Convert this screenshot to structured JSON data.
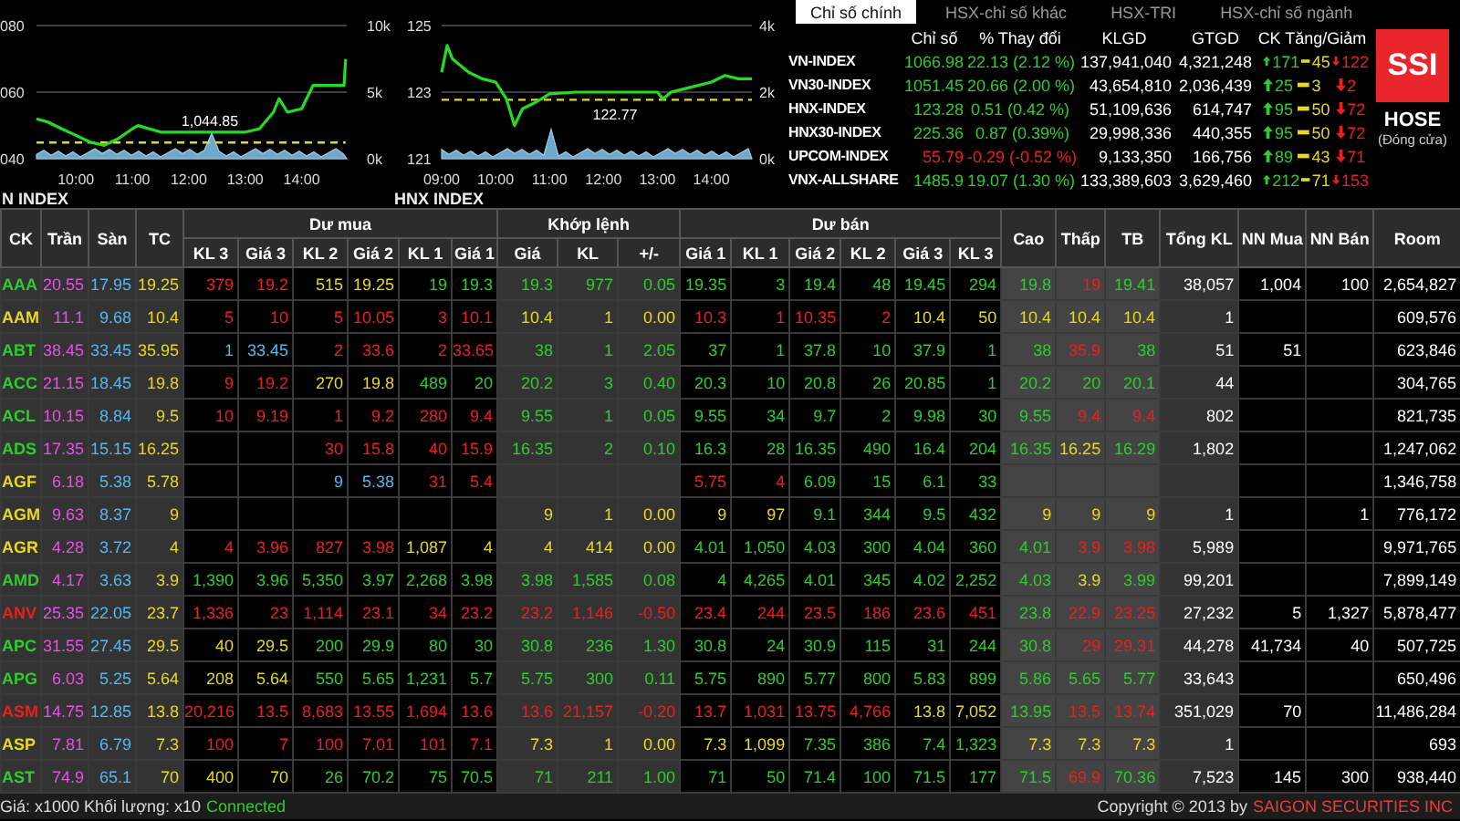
{
  "charts": [
    {
      "title": "N INDEX",
      "right_ticks": [
        "10k",
        "5k",
        "0k"
      ],
      "chart_data": {
        "type": "line",
        "xlim": [
          9.3,
          14.8
        ],
        "ylim": [
          40,
          80
        ],
        "yticks": [
          {
            "value": 80,
            "label": "080"
          },
          {
            "value": 60,
            "label": "060"
          },
          {
            "value": 40,
            "label": "040"
          }
        ],
        "xticks": [
          {
            "value": 10,
            "label": "10:00"
          },
          {
            "value": 11,
            "label": "11:00"
          },
          {
            "value": 12,
            "label": "12:00"
          },
          {
            "value": 13,
            "label": "13:00"
          },
          {
            "value": 14,
            "label": "14:00"
          }
        ],
        "x": [
          9.3,
          9.5,
          9.75,
          10,
          10.25,
          10.5,
          10.75,
          11,
          11.1,
          11.5,
          12,
          12.5,
          13,
          13.25,
          13.5,
          13.6,
          13.75,
          14,
          14.2,
          14.5,
          14.75,
          14.78
        ],
        "series": [
          {
            "color": "#22dd22",
            "values": [
              52,
              51,
              49,
              47,
              45,
              44,
              46,
              49,
              50,
              48,
              48,
              48,
              48,
              49,
              54,
              58,
              54,
              55,
              62,
              62,
              62,
              70
            ]
          },
          {
            "name": "1,044.85",
            "color": "#e8d820",
            "line_style": "dashed",
            "values": [
              44.85,
              44.85,
              44.85,
              44.85,
              44.85,
              44.85,
              44.85,
              44.85,
              44.85,
              44.85,
              44.85,
              44.85,
              44.85,
              44.85,
              44.85,
              44.85,
              44.85,
              44.85,
              44.85,
              44.85,
              44.85,
              44.85
            ]
          }
        ]
      }
    },
    {
      "title": "HNX INDEX",
      "right_ticks": [
        "4k",
        "2k",
        "0k"
      ],
      "chart_data": {
        "type": "line",
        "xlim": [
          9,
          14.75
        ],
        "ylim": [
          121,
          125
        ],
        "yticks": [
          125,
          123,
          121
        ],
        "xticks": [
          {
            "value": 9,
            "label": "09:00"
          },
          {
            "value": 10,
            "label": "10:00"
          },
          {
            "value": 11,
            "label": "11:00"
          },
          {
            "value": 12,
            "label": "12:00"
          },
          {
            "value": 13,
            "label": "13:00"
          },
          {
            "value": 14,
            "label": "14:00"
          }
        ],
        "x": [
          9.0,
          9.1,
          9.2,
          9.5,
          9.75,
          10,
          10.2,
          10.35,
          10.5,
          10.75,
          11,
          11.5,
          12,
          12.5,
          13,
          13.1,
          13.25,
          13.5,
          14,
          14.25,
          14.5,
          14.75
        ],
        "series": [
          {
            "color": "#22dd22",
            "values": [
              123.6,
              124.4,
              124,
              123.6,
              123.4,
              123.3,
              122.8,
              122.0,
              122.5,
              122.7,
              122.95,
              123,
              123,
              123,
              123,
              122.8,
              123,
              123.1,
              123.3,
              123.5,
              123.4,
              123.4
            ]
          },
          {
            "name": "122.77",
            "color": "#e8d820",
            "line_style": "dashed",
            "values": [
              122.77,
              122.77,
              122.77,
              122.77,
              122.77,
              122.77,
              122.77,
              122.77,
              122.77,
              122.77,
              122.77,
              122.77,
              122.77,
              122.77,
              122.77,
              122.77,
              122.77,
              122.77,
              122.77,
              122.77,
              122.77,
              122.77
            ]
          }
        ]
      }
    }
  ],
  "index_tabs": [
    {
      "label": "Chỉ số chính",
      "selected": true
    },
    {
      "label": "HSX-chỉ số khác",
      "selected": false
    },
    {
      "label": "HSX-TRI",
      "selected": false
    },
    {
      "label": "HSX-chỉ số ngành",
      "selected": false
    }
  ],
  "index_columns": [
    "Chỉ số",
    "% Thay đổi",
    "KLGD",
    "GTGD",
    "CK Tăng/Giảm"
  ],
  "indices": [
    {
      "name": "VN-INDEX",
      "value": "1066.98",
      "change": "22.13 (2.12 %)",
      "klgd": "137,941,040",
      "gtgd": "4,321,248",
      "up": "171",
      "same": "45",
      "down": "122"
    },
    {
      "name": "VN30-INDEX",
      "value": "1051.45",
      "change": "20.66 (2.00 %)",
      "klgd": "43,654,810",
      "gtgd": "2,036,439",
      "up": "25",
      "same": "3",
      "down": "2"
    },
    {
      "name": "HNX-INDEX",
      "value": "123.28",
      "change": "0.51 (0.42 %)",
      "klgd": "51,109,636",
      "gtgd": "614,747",
      "up": "95",
      "same": "50",
      "down": "72"
    },
    {
      "name": "HNX30-INDEX",
      "value": "225.36",
      "change": "0.87 (0.39%)",
      "klgd": "29,998,336",
      "gtgd": "440,355",
      "up": "95",
      "same": "50",
      "down": "72"
    },
    {
      "name": "UPCOM-INDEX",
      "value": "55.79",
      "change": "-0.29 (-0.52 %)",
      "klgd": "9,133,350",
      "gtgd": "166,756",
      "up": "89",
      "same": "43",
      "down": "71"
    },
    {
      "name": "VNX-ALLSHARE",
      "value": "1485.9",
      "change": "19.07 (1.30 %)",
      "klgd": "133,389,603",
      "gtgd": "3,629,460",
      "up": "212",
      "same": "71",
      "down": "153"
    }
  ],
  "logo": {
    "text": "SSI",
    "exchange": "HOSE",
    "status": "(Đóng cửa)"
  },
  "board": {
    "groups": [
      {
        "label": "CK"
      },
      {
        "label": "Trần"
      },
      {
        "label": "Sàn"
      },
      {
        "label": "TC"
      },
      {
        "label": "Dư mua",
        "columns": [
          "KL 3",
          "Giá 3",
          "KL 2",
          "Giá 2",
          "KL 1",
          "Giá 1"
        ]
      },
      {
        "label": "Khớp lệnh",
        "columns": [
          "Giá",
          "KL",
          "+/-"
        ]
      },
      {
        "label": "Dư bán",
        "columns": [
          "Giá 1",
          "KL 1",
          "Giá 2",
          "KL 2",
          "Giá 3",
          "KL 3"
        ]
      },
      {
        "label": "Cao"
      },
      {
        "label": "Thấp"
      },
      {
        "label": "TB"
      },
      {
        "label": "Tổng KL"
      },
      {
        "label": "NN Mua"
      },
      {
        "label": "NN Bán"
      },
      {
        "label": "Room"
      }
    ],
    "rows": [
      [
        "AAA",
        "20.55",
        "17.95",
        "19.25",
        "379",
        "19.2",
        "515",
        "19.25",
        "19",
        "19.3",
        "19.3",
        "977",
        "0.05",
        "19.35",
        "3",
        "19.4",
        "48",
        "19.45",
        "294",
        "19.8",
        "19",
        "19.41",
        "38,057",
        "1,004",
        "100",
        "2,654,827"
      ],
      [
        "AAM",
        "11.1",
        "9.68",
        "10.4",
        "5",
        "10",
        "5",
        "10.05",
        "3",
        "10.1",
        "10.4",
        "1",
        "0.00",
        "10.3",
        "1",
        "10.35",
        "2",
        "10.4",
        "50",
        "10.4",
        "10.4",
        "10.4",
        "1",
        "",
        "",
        "609,576"
      ],
      [
        "ABT",
        "38.45",
        "33.45",
        "35.95",
        "1",
        "33.45",
        "2",
        "33.6",
        "2",
        "33.65",
        "38",
        "1",
        "2.05",
        "37",
        "1",
        "37.8",
        "10",
        "37.9",
        "1",
        "38",
        "35.9",
        "38",
        "51",
        "51",
        "",
        "623,846"
      ],
      [
        "ACC",
        "21.15",
        "18.45",
        "19.8",
        "9",
        "19.2",
        "270",
        "19.8",
        "489",
        "20",
        "20.2",
        "3",
        "0.40",
        "20.3",
        "10",
        "20.8",
        "26",
        "20.85",
        "1",
        "20.2",
        "20",
        "20.1",
        "44",
        "",
        "",
        "304,765"
      ],
      [
        "ACL",
        "10.15",
        "8.84",
        "9.5",
        "10",
        "9.19",
        "1",
        "9.2",
        "280",
        "9.4",
        "9.55",
        "1",
        "0.05",
        "9.55",
        "34",
        "9.7",
        "2",
        "9.98",
        "30",
        "9.55",
        "9.4",
        "9.4",
        "802",
        "",
        "",
        "821,735"
      ],
      [
        "ADS",
        "17.35",
        "15.15",
        "16.25",
        "",
        "",
        "30",
        "15.8",
        "40",
        "15.9",
        "16.35",
        "2",
        "0.10",
        "16.3",
        "28",
        "16.35",
        "490",
        "16.4",
        "204",
        "16.35",
        "16.25",
        "16.29",
        "1,802",
        "",
        "",
        "1,247,062"
      ],
      [
        "AGF",
        "6.18",
        "5.38",
        "5.78",
        "",
        "",
        "9",
        "5.38",
        "31",
        "5.4",
        "",
        "",
        "",
        "5.75",
        "4",
        "6.09",
        "15",
        "6.1",
        "33",
        "",
        "",
        "",
        "",
        "",
        "",
        "1,346,758"
      ],
      [
        "AGM",
        "9.63",
        "8.37",
        "9",
        "",
        "",
        "",
        "",
        "",
        "",
        "9",
        "1",
        "0.00",
        "9",
        "97",
        "9.1",
        "344",
        "9.5",
        "432",
        "9",
        "9",
        "9",
        "1",
        "",
        "1",
        "776,172"
      ],
      [
        "AGR",
        "4.28",
        "3.72",
        "4",
        "4",
        "3.96",
        "827",
        "3.98",
        "1,087",
        "4",
        "4",
        "414",
        "0.00",
        "4.01",
        "1,050",
        "4.03",
        "300",
        "4.04",
        "360",
        "4.01",
        "3.9",
        "3.98",
        "5,989",
        "",
        "",
        "9,971,765"
      ],
      [
        "AMD",
        "4.17",
        "3.63",
        "3.9",
        "1,390",
        "3.96",
        "5,350",
        "3.97",
        "2,268",
        "3.98",
        "3.98",
        "1,585",
        "0.08",
        "4",
        "4,265",
        "4.01",
        "345",
        "4.02",
        "2,252",
        "4.03",
        "3.9",
        "3.99",
        "99,201",
        "",
        "",
        "7,899,149"
      ],
      [
        "ANV",
        "25.35",
        "22.05",
        "23.7",
        "1,336",
        "23",
        "1,114",
        "23.1",
        "34",
        "23.2",
        "23.2",
        "1,146",
        "-0.50",
        "23.4",
        "244",
        "23.5",
        "186",
        "23.6",
        "451",
        "23.8",
        "22.9",
        "23.25",
        "27,232",
        "5",
        "1,327",
        "5,878,477"
      ],
      [
        "APC",
        "31.55",
        "27.45",
        "29.5",
        "40",
        "29.5",
        "200",
        "29.9",
        "80",
        "30",
        "30.8",
        "236",
        "1.30",
        "30.8",
        "24",
        "30.9",
        "115",
        "31",
        "244",
        "30.8",
        "29",
        "29.31",
        "44,278",
        "41,734",
        "40",
        "507,725"
      ],
      [
        "APG",
        "6.03",
        "5.25",
        "5.64",
        "208",
        "5.64",
        "550",
        "5.65",
        "1,231",
        "5.7",
        "5.75",
        "300",
        "0.11",
        "5.75",
        "890",
        "5.77",
        "800",
        "5.83",
        "899",
        "5.86",
        "5.65",
        "5.77",
        "33,643",
        "",
        "",
        "650,496"
      ],
      [
        "ASM",
        "14.75",
        "12.85",
        "13.8",
        "20,216",
        "13.5",
        "8,683",
        "13.55",
        "1,694",
        "13.6",
        "13.6",
        "21,157",
        "-0.20",
        "13.7",
        "1,031",
        "13.75",
        "4,766",
        "13.8",
        "7,052",
        "13.95",
        "13.5",
        "13.74",
        "351,029",
        "70",
        "",
        "11,486,284"
      ],
      [
        "ASP",
        "7.81",
        "6.79",
        "7.3",
        "100",
        "7",
        "100",
        "7.01",
        "101",
        "7.1",
        "7.3",
        "1",
        "0.00",
        "7.3",
        "1,099",
        "7.35",
        "386",
        "7.4",
        "1,323",
        "7.3",
        "7.3",
        "7.3",
        "1",
        "",
        "",
        "693"
      ],
      [
        "AST",
        "74.9",
        "65.1",
        "70",
        "400",
        "70",
        "26",
        "70.2",
        "75",
        "70.5",
        "71",
        "211",
        "1.00",
        "71",
        "50",
        "71.4",
        "100",
        "71.5",
        "177",
        "71.5",
        "69.9",
        "70.36",
        "7,523",
        "145",
        "300",
        "938,440"
      ]
    ]
  },
  "footer": {
    "units": "Giá: x1000 Khối lượng: x10",
    "connection": "Connected",
    "copyright": "Copyright © 2013 by",
    "company": "SAIGON SECURITIES INC"
  }
}
